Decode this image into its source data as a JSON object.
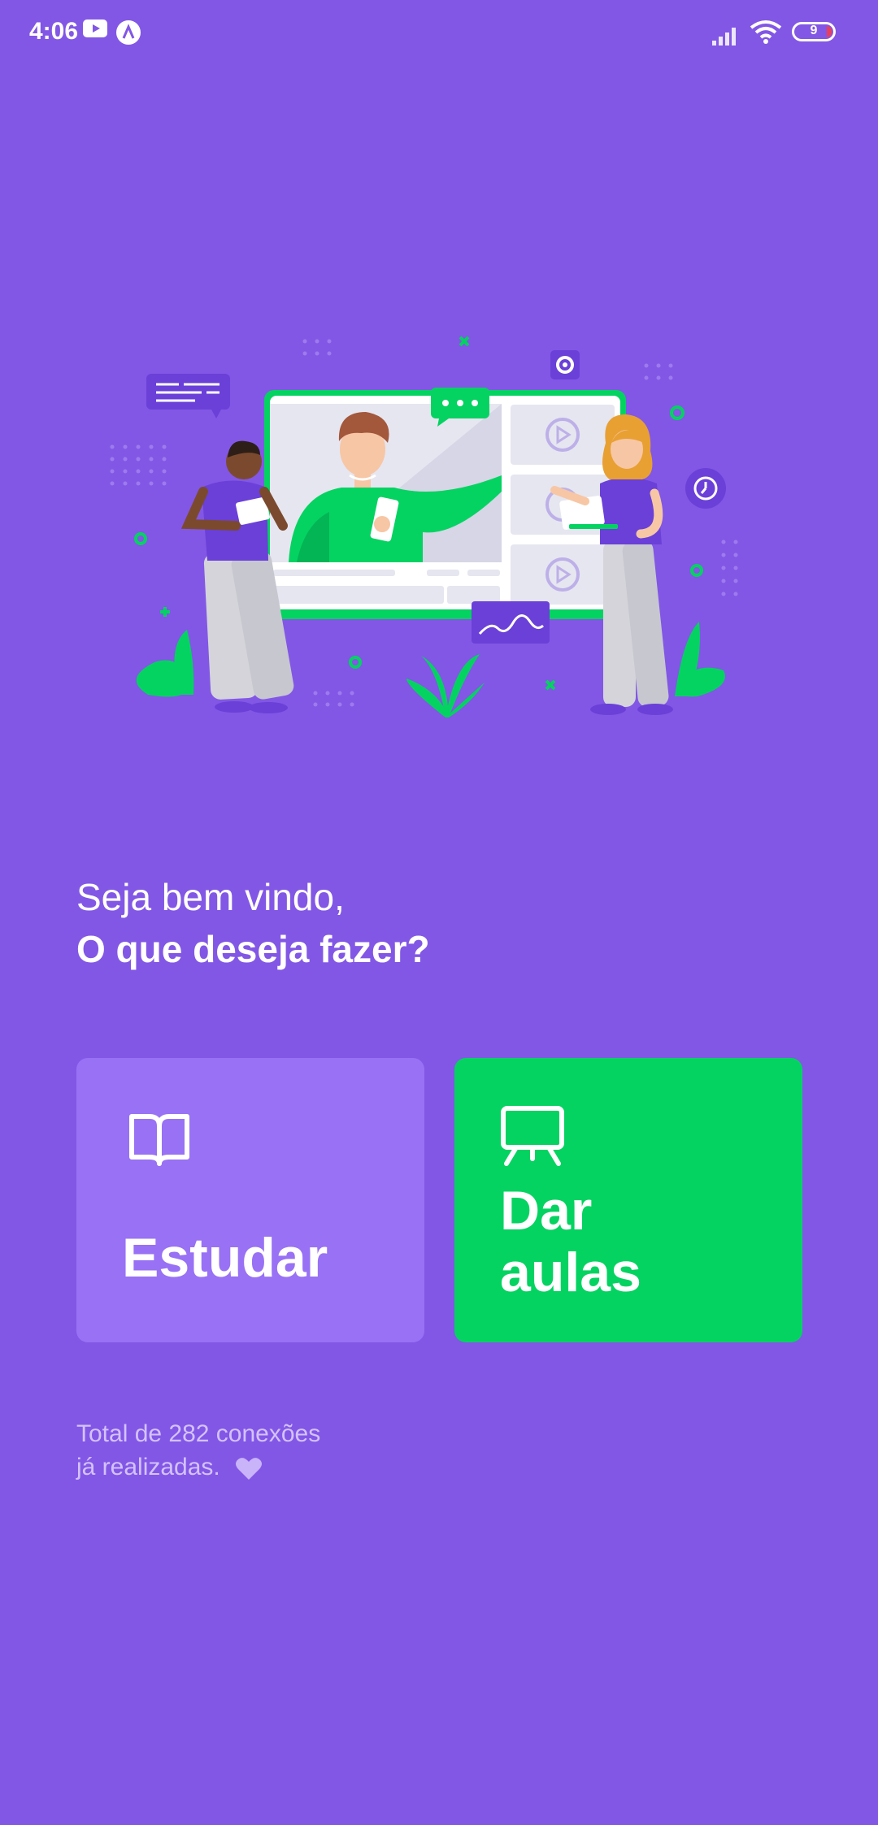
{
  "status_bar": {
    "time": "4:06",
    "battery_level": "9",
    "icons": [
      "youtube-icon",
      "app-a-icon",
      "signal-icon",
      "wifi-icon",
      "battery-icon"
    ]
  },
  "hero": {
    "illustration": "online-classes-illustration"
  },
  "greeting": {
    "line1": "Seja bem vindo,",
    "line2": "O que deseja fazer?"
  },
  "actions": {
    "study": {
      "label": "Estudar",
      "icon": "book-open-icon",
      "color": "#9871F5"
    },
    "teach": {
      "label_line1": "Dar",
      "label_line2": "aulas",
      "icon": "presentation-board-icon",
      "color": "#04D361"
    }
  },
  "footer": {
    "line1": "Total de 282 conexões",
    "line2": "já realizadas.",
    "icon": "heart-icon"
  },
  "colors": {
    "background": "#8257E5",
    "accent_green": "#04D361",
    "accent_purple_light": "#9871F5",
    "text_muted": "#D4C2FF"
  }
}
